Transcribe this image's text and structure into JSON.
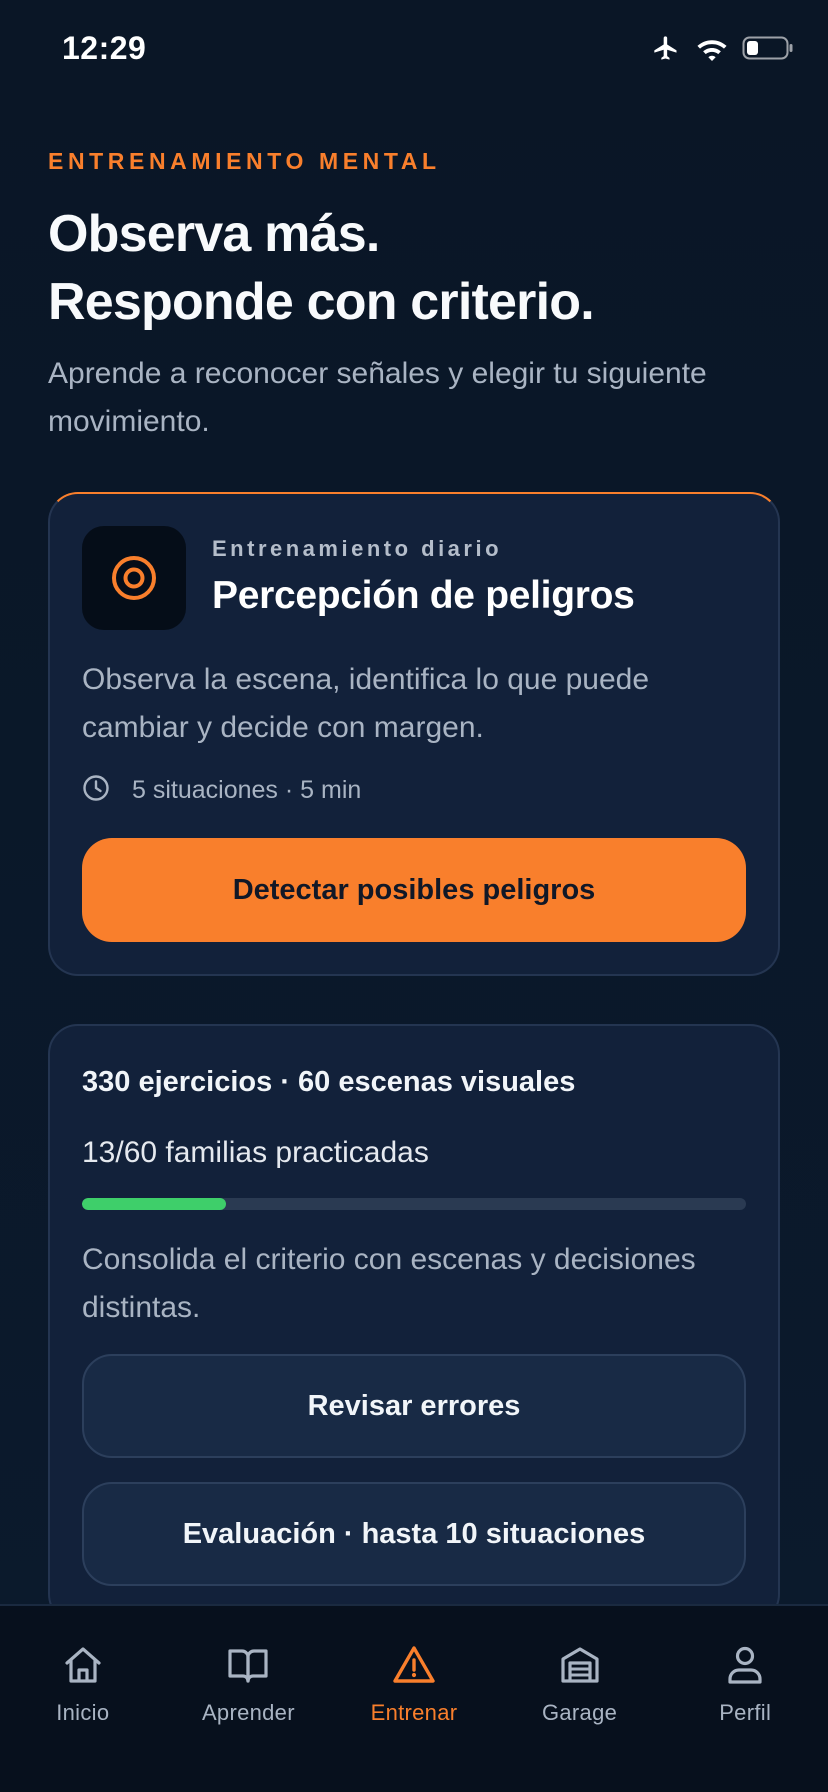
{
  "status_bar": {
    "time": "12:29",
    "icons": [
      "airplane-icon",
      "wifi-icon",
      "battery-icon"
    ]
  },
  "header": {
    "eyebrow": "ENTRENAMIENTO MENTAL",
    "headline_line1": "Observa más.",
    "headline_line2": "Responde con criterio.",
    "subtitle": "Aprende a reconocer señales y elegir tu siguiente movimiento."
  },
  "daily_card": {
    "icon": "target-icon",
    "kicker": "Entrenamiento diario",
    "title": "Percepción de peligros",
    "description": "Observa la escena, identifica lo que puede cambiar y decide con margen.",
    "meta_icon": "clock-icon",
    "meta": "5 situaciones · 5 min",
    "cta_label": "Detectar posibles peligros"
  },
  "progress_card": {
    "stats": "330 ejercicios · 60 escenas visuales",
    "families": "13/60 familias practicadas",
    "progress_fraction": 0.217,
    "description": "Consolida el criterio con escenas y decisiones distintas.",
    "review_label": "Revisar errores",
    "evaluation_label": "Evaluación · hasta 10 situaciones"
  },
  "bottom_nav": {
    "items": [
      {
        "label": "Inicio",
        "icon": "home-icon",
        "active": false
      },
      {
        "label": "Aprender",
        "icon": "book-icon",
        "active": false
      },
      {
        "label": "Entrenar",
        "icon": "warning-triangle-icon",
        "active": true
      },
      {
        "label": "Garage",
        "icon": "garage-icon",
        "active": false
      },
      {
        "label": "Perfil",
        "icon": "user-icon",
        "active": false
      }
    ]
  },
  "colors": {
    "accent": "#f97f2c",
    "progress": "#3ecf6a",
    "background": "#0a1628",
    "card": "#12213a"
  }
}
